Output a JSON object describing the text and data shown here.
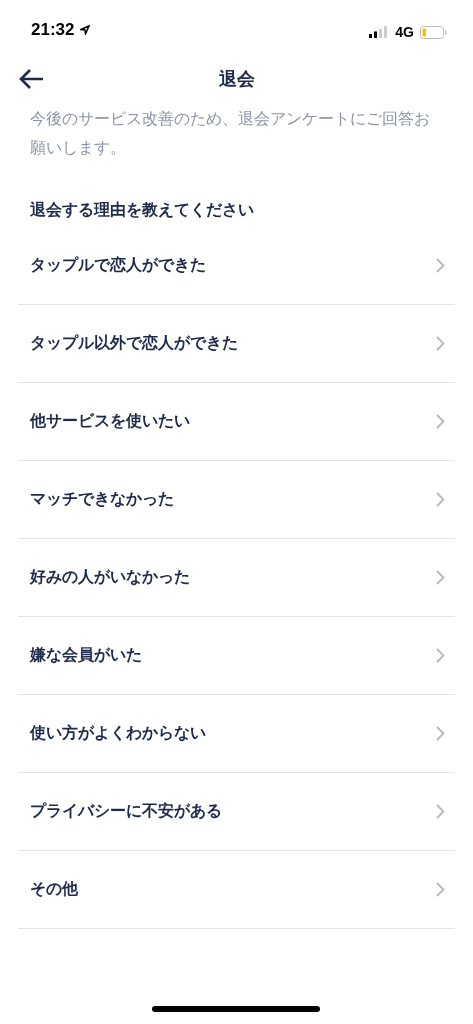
{
  "status_bar": {
    "time": "21:32",
    "network": "4G"
  },
  "nav": {
    "title": "退会"
  },
  "intro": "今後のサービス改善のため、退会アンケートにご回答お願いします。",
  "heading": "退会する理由を教えてください",
  "reasons": [
    {
      "label": "タップルで恋人ができた"
    },
    {
      "label": "タップル以外で恋人ができた"
    },
    {
      "label": "他サービスを使いたい"
    },
    {
      "label": "マッチできなかった"
    },
    {
      "label": "好みの人がいなかった"
    },
    {
      "label": "嫌な会員がいた"
    },
    {
      "label": "使い方がよくわからない"
    },
    {
      "label": "プライバシーに不安がある"
    },
    {
      "label": "その他"
    }
  ]
}
